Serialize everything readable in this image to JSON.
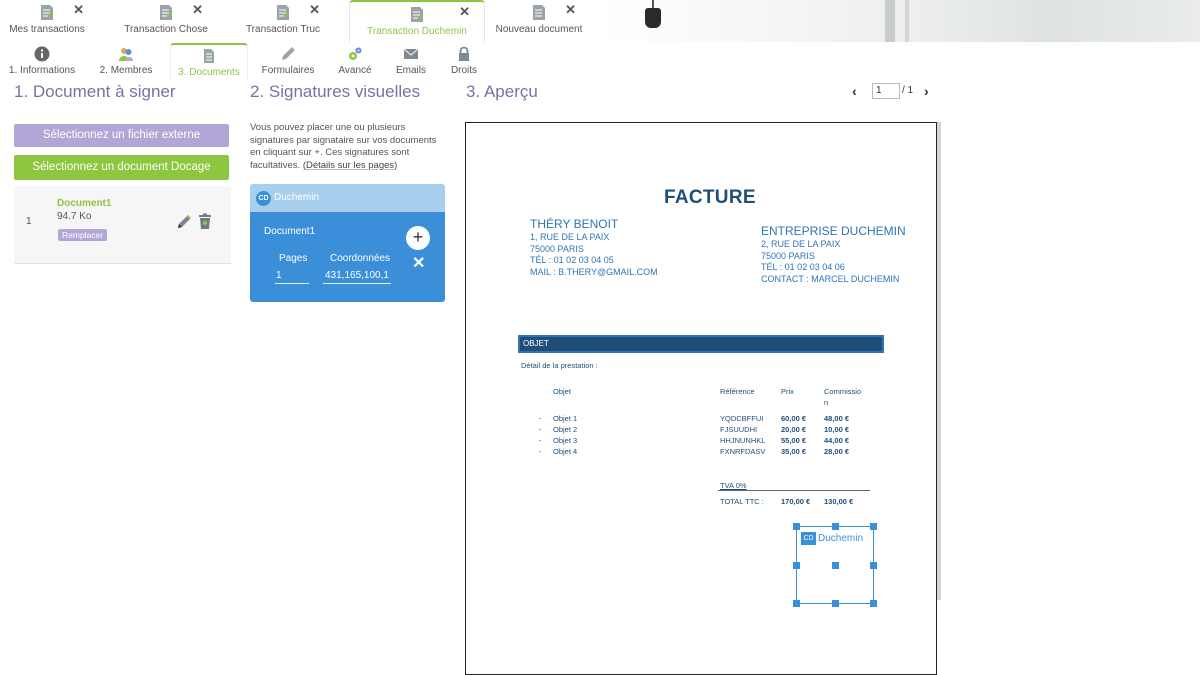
{
  "top_tabs": [
    {
      "label": "Mes transactions",
      "active": false
    },
    {
      "label": "Transaction Chose",
      "active": false
    },
    {
      "label": "Transaction Truc",
      "active": false
    },
    {
      "label": "Transaction Duchemin",
      "active": true
    },
    {
      "label": "Nouveau document",
      "active": false
    }
  ],
  "sub_tabs": [
    {
      "label": "1. Informations",
      "icon": "info-icon"
    },
    {
      "label": "2. Membres",
      "icon": "members-icon"
    },
    {
      "label": "3. Documents",
      "icon": "document-icon",
      "active": true
    },
    {
      "label": "Formulaires",
      "icon": "pencil-icon"
    },
    {
      "label": "Avancé",
      "icon": "gears-icon"
    },
    {
      "label": "Emails",
      "icon": "envelope-icon"
    },
    {
      "label": "Droits",
      "icon": "lock-icon"
    }
  ],
  "columns": {
    "col1_title": "1. Document à signer",
    "col2_title": "2. Signatures visuelles",
    "col3_title": "3. Aperçu"
  },
  "document_panel": {
    "select_external_label": "Sélectionnez un fichier externe",
    "select_docage_label": "Sélectionnez un document Docage",
    "document": {
      "index": "1",
      "name": "Document1",
      "size": "94.7 Ko",
      "replace_label": "Remplacer"
    }
  },
  "signature_panel": {
    "intro": "Vous pouvez placer une ou plusieurs signatures par signataire sur vos documents en cliquant sur +. Ces signatures sont facultatives.",
    "details_link": "(Détails sur les pages)",
    "signer": {
      "initials": "CD",
      "name": "Duchemin",
      "document_name": "Document1",
      "pages_label": "Pages",
      "coords_label": "Coordonnées",
      "pages_value": "1",
      "coords_value": "431,165,100,1"
    }
  },
  "pager": {
    "current": "1",
    "total": "/ 1"
  },
  "invoice": {
    "title": "FACTURE",
    "from": {
      "name": "THÉRY BENOIT",
      "line1": "1, RUE DE LA PAIX",
      "line2": "75000 PARIS",
      "line3": "TÉL : 01 02 03 04 05",
      "line4": "MAIL : B.THERY@GMAIL.COM"
    },
    "to": {
      "name": "ENTREPRISE DUCHEMIN",
      "line1": "2, RUE DE LA PAIX",
      "line2": "75000 PARIS",
      "line3": "TÉL : 01 02 03 04 06",
      "line4": "CONTACT : MARCEL DUCHEMIN"
    },
    "objet_header": "OBJET",
    "detail_label": "Détail de la prestation :",
    "columns": {
      "objet": "Objet",
      "reference": "Référence",
      "prix": "Prix",
      "commission": "Commissio",
      "commission2": "n"
    },
    "rows": [
      {
        "bullet": "-",
        "objet": "Objet 1",
        "reference": "YQDCBFFUI",
        "prix": "60,00 €",
        "commission": "48,00 €"
      },
      {
        "bullet": "-",
        "objet": "Objet 2",
        "reference": "FJSUUDHI",
        "prix": "20,00 €",
        "commission": "10,00 €"
      },
      {
        "bullet": "-",
        "objet": "Objet 3",
        "reference": "HHJNUNHKL",
        "prix": "55,00 €",
        "commission": "44,00 €"
      },
      {
        "bullet": "-",
        "objet": "Objet 4",
        "reference": "FXNRFDASV",
        "prix": "35,00 €",
        "commission": "28,00 €"
      }
    ],
    "tva_label": "TVA 0%",
    "total_label": "TOTAL  TTC :",
    "total_prix": "170,00 €",
    "total_commission": "130,00 €"
  },
  "signature_overlay": {
    "initials": "CD",
    "name": "Duchemin"
  },
  "colors": {
    "accent_green": "#8dc63f",
    "accent_purple": "#b2a6d6",
    "title_purple": "#7d6fa6",
    "signer_blue": "#3a8fd8",
    "invoice_blue": "#1f4e79"
  }
}
